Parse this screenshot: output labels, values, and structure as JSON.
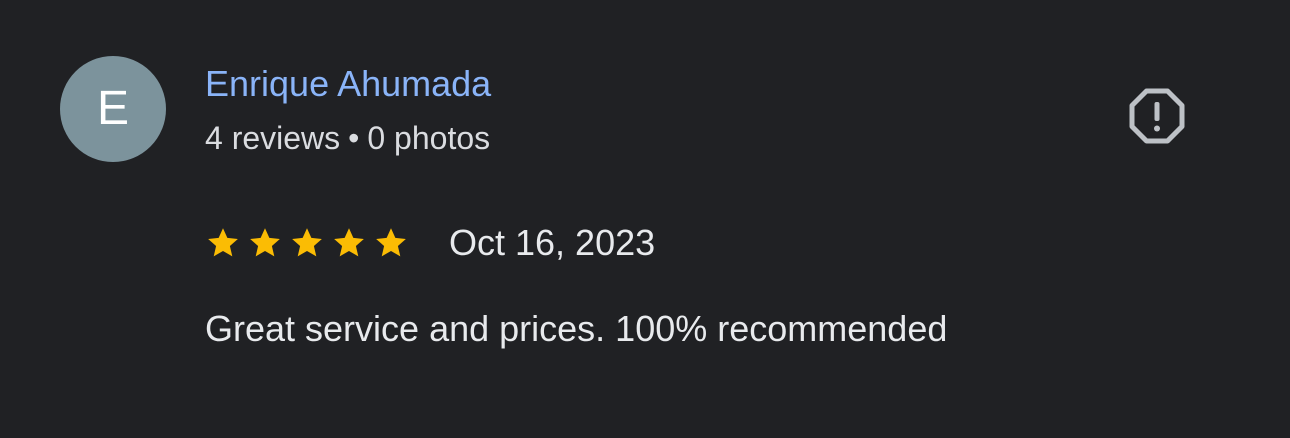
{
  "review": {
    "avatar_initial": "E",
    "author_name": "Enrique Ahumada",
    "reviews_count": "4 reviews",
    "separator": "•",
    "photos_count": "0 photos",
    "rating": 5,
    "rating_max": 5,
    "date": "Oct 16, 2023",
    "text": "Great service and prices. 100% recommended"
  },
  "colors": {
    "background": "#202124",
    "author_link": "#8ab4f8",
    "avatar_bg": "#7c939c",
    "star": "#fbbc04",
    "icon": "#bdc1c6"
  },
  "icons": {
    "report": "report-flag-icon",
    "star": "star-icon"
  }
}
